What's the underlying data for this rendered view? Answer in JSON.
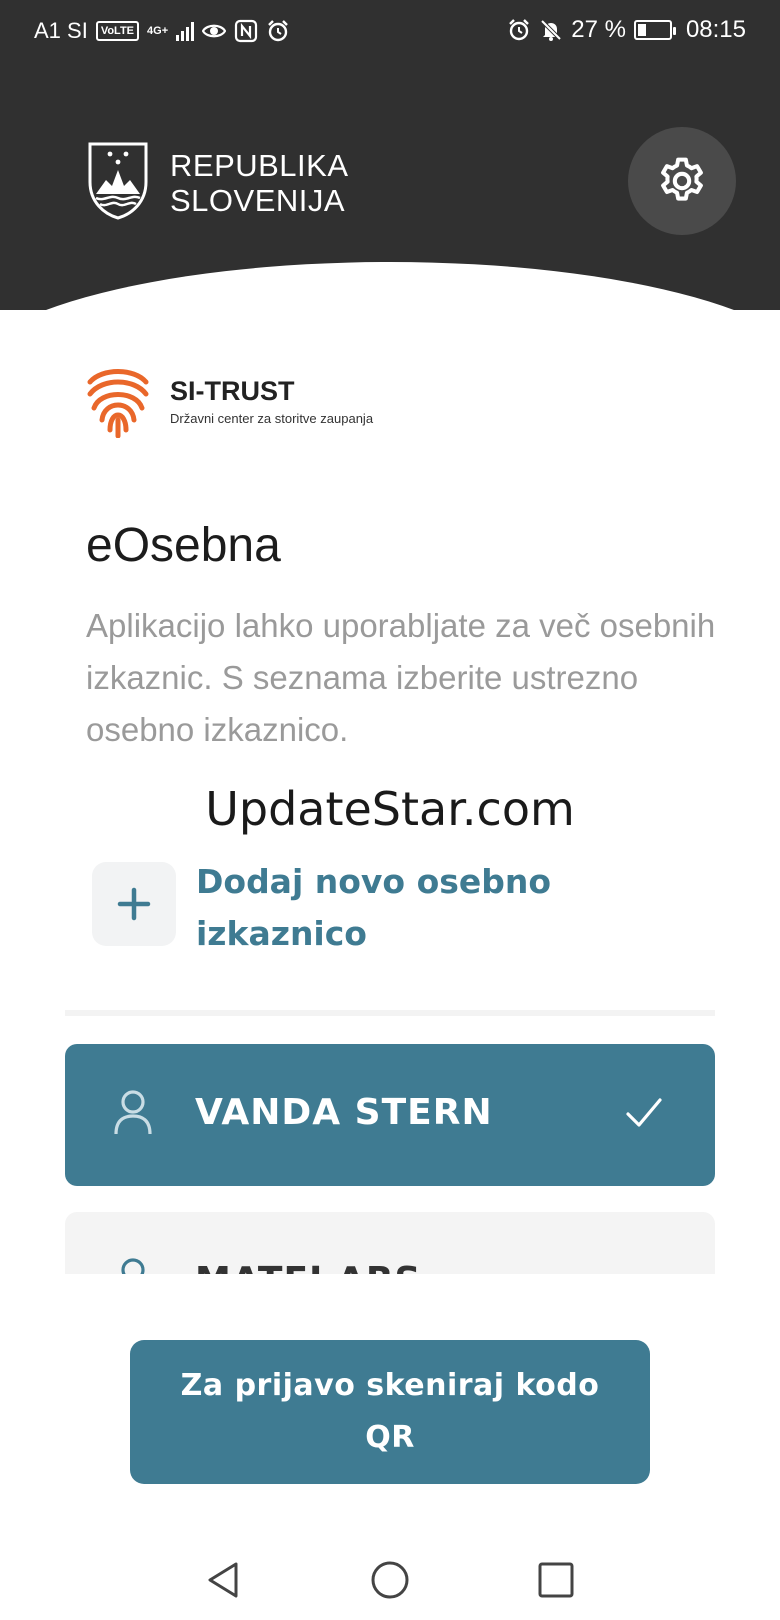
{
  "status_bar": {
    "carrier": "A1 SI",
    "volte": "VoLTE",
    "network": "4G+",
    "battery": "27 %",
    "battery_level": 0.27,
    "time": "08:15"
  },
  "header": {
    "line1": "REPUBLIKA",
    "line2": "SLOVENIJA",
    "settings_icon": "gear-icon"
  },
  "brand": {
    "name": "SI-TRUST",
    "subtitle": "Državni center za storitve zaupanja"
  },
  "main": {
    "title": "eOsebna",
    "description": "Aplikacijo lahko uporabljate za več osebnih izkaznic. S seznama izberite ustrezno osebno izkaznico.",
    "watermark": "UpdateStar.com",
    "add_label": "Dodaj novo osebno izkaznico"
  },
  "ids": [
    {
      "name": "VANDA STERN",
      "selected": true
    },
    {
      "name": "MATEJ ARS",
      "selected": false
    }
  ],
  "qr_button": {
    "label": "Za prijavo skeniraj kodo QR"
  },
  "colors": {
    "header": "#303030",
    "accent": "#3f7b92",
    "brand_orange": "#e9672a"
  }
}
